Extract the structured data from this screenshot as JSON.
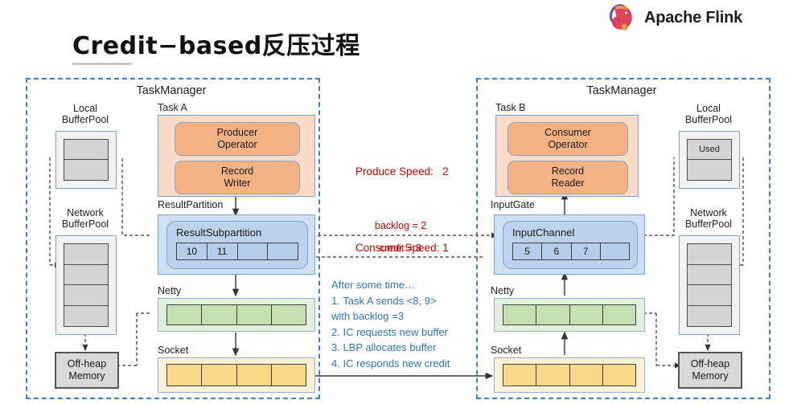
{
  "header": {
    "title": "Credit−based反压过程",
    "brand": "Apache Flink",
    "brand_logo_icon": "flink-squirrel-logo"
  },
  "annotations": {
    "produce_speed_label": "Produce Speed:",
    "produce_speed_value": "2",
    "consume_speed_label": "Consume Speed:",
    "consume_speed_value": "1",
    "backlog_label": "backlog = 2",
    "credit_label": "credit = 3",
    "steps_heading": "After some time…",
    "steps": [
      "1.    Task A sends <8, 9>",
      "with backlog =3",
      "2.    IC requests new buffer",
      "3.    LBP allocates buffer",
      "4.    IC responds new credit"
    ]
  },
  "colors": {
    "panel_border": "#3b7dd8",
    "annotation_red": "#c00000",
    "annotation_blue": "#2e75b6",
    "task_fill": "#f4b183",
    "partition_fill": "#b4cde8",
    "netty_fill": "#c6dfb2",
    "socket_fill": "#fcd98a",
    "pool_fill": "#d4d4d4"
  },
  "left_taskmanager": {
    "title": "TaskManager",
    "local_bufferpool": {
      "label_line1": "Local",
      "label_line2": "BufferPool",
      "cells": [
        "",
        ""
      ]
    },
    "network_bufferpool": {
      "label_line1": "Network",
      "label_line2": "BufferPool",
      "cells": [
        "",
        "",
        "",
        ""
      ]
    },
    "offheap": {
      "line1": "Off-heap",
      "line2": "Memory"
    },
    "task": {
      "label": "Task A",
      "operator": {
        "line1": "Producer",
        "line2": "Operator"
      },
      "record": {
        "line1": "Record",
        "line2": "Writer"
      }
    },
    "result_partition": {
      "label": "ResultPartition",
      "subpartition_label": "ResultSubpartition",
      "cells": [
        "10",
        "11",
        "",
        ""
      ]
    },
    "netty": {
      "label": "Netty",
      "cells": [
        "",
        "",
        "",
        ""
      ]
    },
    "socket": {
      "label": "Socket",
      "cells": [
        "",
        "",
        "",
        ""
      ]
    }
  },
  "right_taskmanager": {
    "title": "TaskManager",
    "local_bufferpool": {
      "label_line1": "Local",
      "label_line2": "BufferPool",
      "cells": [
        "Used",
        ""
      ]
    },
    "network_bufferpool": {
      "label_line1": "Network",
      "label_line2": "BufferPool",
      "cells": [
        "",
        "",
        "",
        ""
      ]
    },
    "offheap": {
      "line1": "Off-heap",
      "line2": "Memory"
    },
    "task": {
      "label": "Task B",
      "operator": {
        "line1": "Consumer",
        "line2": "Operator"
      },
      "record": {
        "line1": "Record",
        "line2": "Reader"
      }
    },
    "input_gate": {
      "label": "InputGate",
      "channel_label": "InputChannel",
      "cells": [
        "5",
        "6",
        "7",
        ""
      ]
    },
    "netty": {
      "label": "Netty",
      "cells": [
        "",
        "",
        "",
        ""
      ]
    },
    "socket": {
      "label": "Socket",
      "cells": [
        "",
        "",
        "",
        ""
      ]
    }
  }
}
